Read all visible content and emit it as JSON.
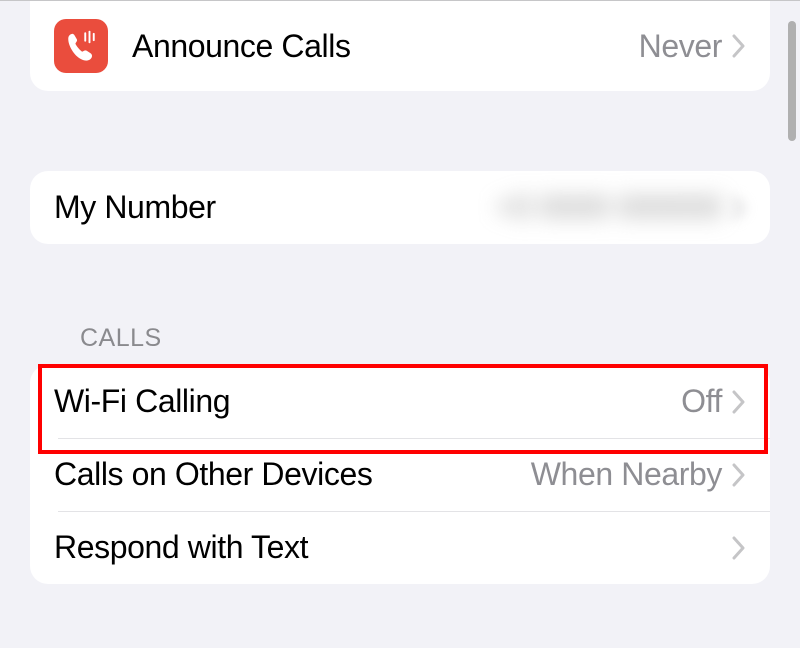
{
  "group1": {
    "announce_calls": {
      "label": "Announce Calls",
      "value": "Never",
      "icon": "voicemail-phone"
    }
  },
  "group2": {
    "my_number": {
      "label": "My Number",
      "value": "+0 0000 000000"
    }
  },
  "calls_section": {
    "header": "CALLS",
    "wifi_calling": {
      "label": "Wi-Fi Calling",
      "value": "Off"
    },
    "calls_on_other_devices": {
      "label": "Calls on Other Devices",
      "value": "When Nearby"
    },
    "respond_with_text": {
      "label": "Respond with Text"
    }
  },
  "highlight_target": "wifi-calling-row"
}
